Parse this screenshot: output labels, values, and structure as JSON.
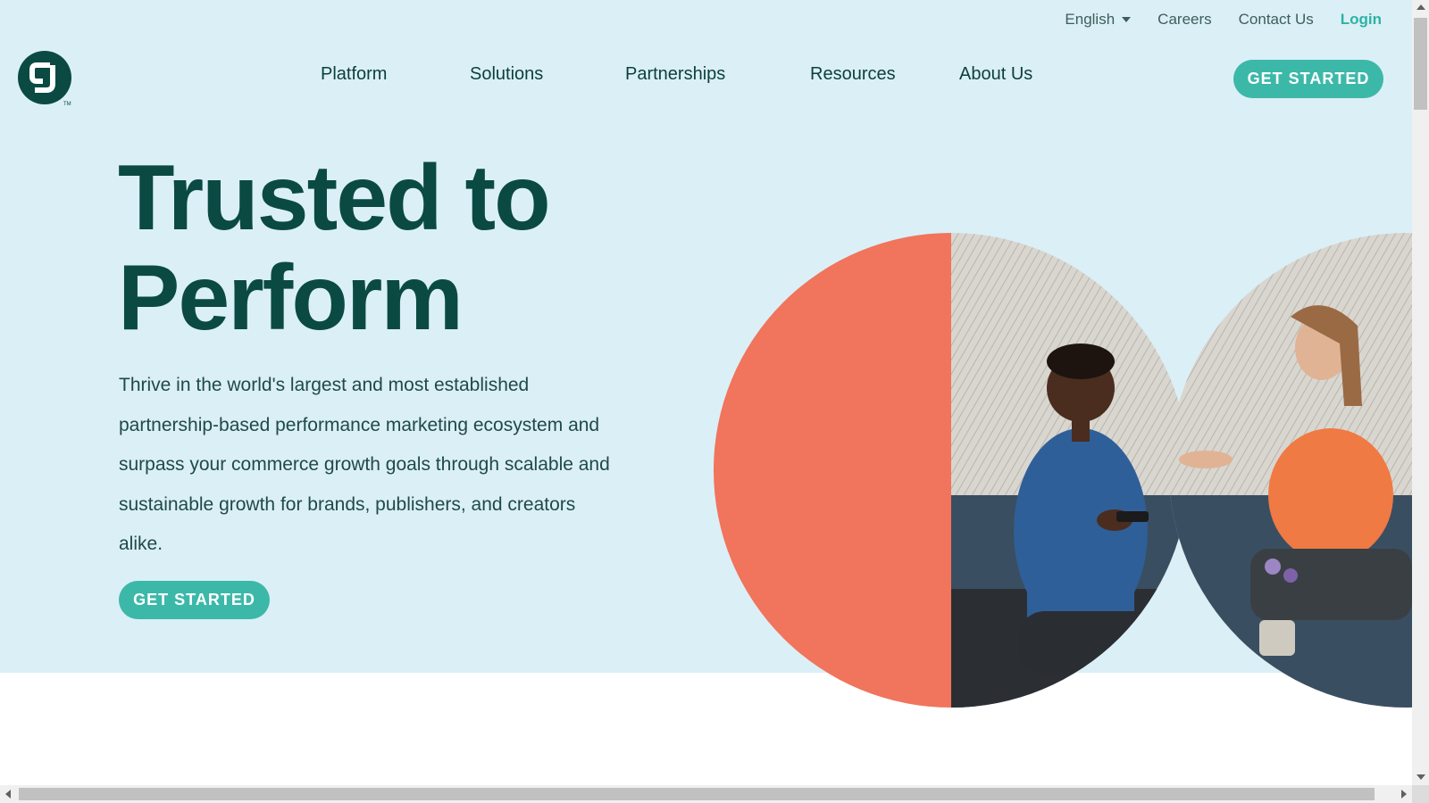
{
  "utility_nav": {
    "language": "English",
    "careers": "Careers",
    "contact": "Contact Us",
    "login": "Login"
  },
  "logo": {
    "icon": "cj-logo-icon",
    "trademark": "TM"
  },
  "main_nav": {
    "items": [
      "Platform",
      "Solutions",
      "Partnerships",
      "Resources",
      "About Us"
    ],
    "cta": "GET STARTED"
  },
  "hero": {
    "headline_line1": "Trusted to",
    "headline_line2": "Perform",
    "body": "Thrive in the world's largest and most established partnership-based performance marketing ecosystem and surpass your commerce growth goals through scalable and sustainable growth for brands, publishers, and creators alike.",
    "cta": "GET STARTED",
    "image": "two-people-conversation-photo"
  },
  "colors": {
    "hero_bg": "#dbeff7",
    "brand_dark": "#0a4a43",
    "accent_teal": "#3cb8a9",
    "coral": "#f1745c"
  }
}
